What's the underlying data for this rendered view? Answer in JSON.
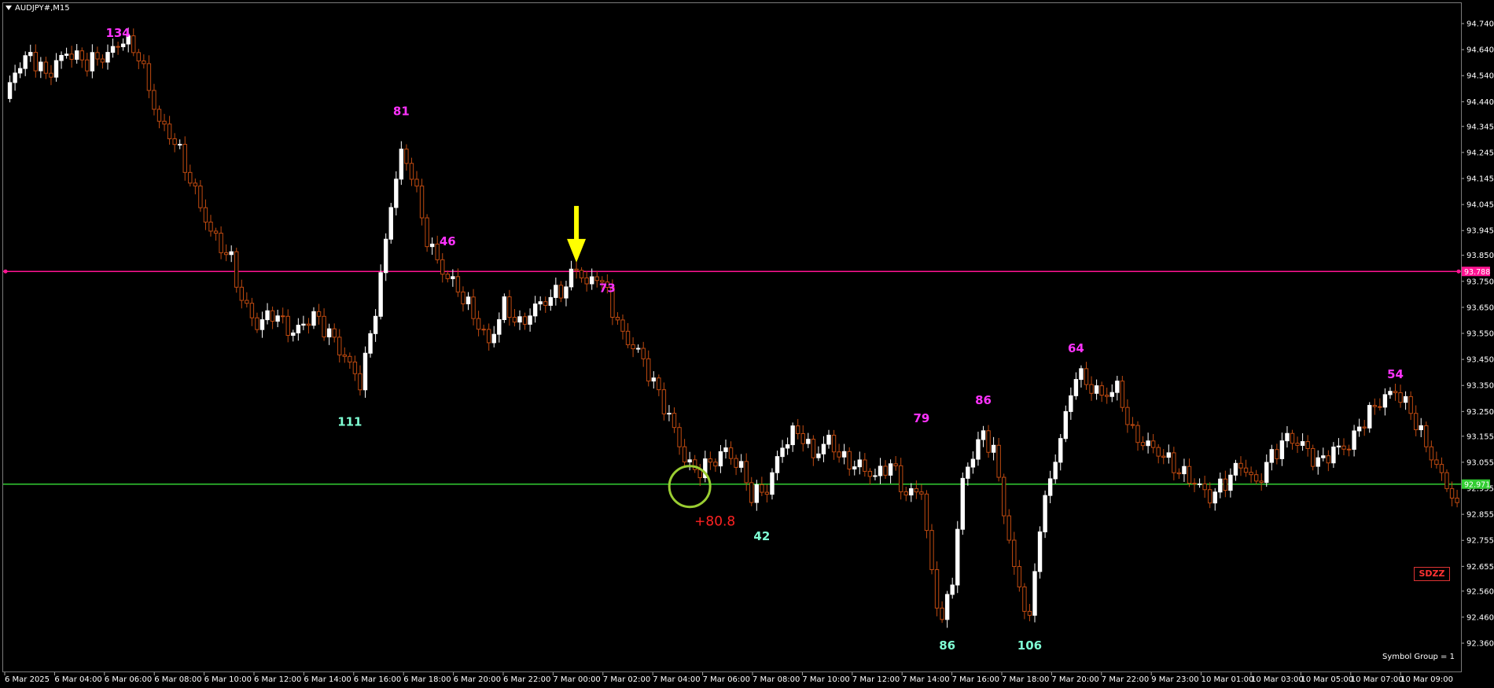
{
  "window": {
    "symbol_title": "AUDJPY#,M15"
  },
  "colors": {
    "background": "#000000",
    "bull_candle": "#ffffff",
    "bear_candle": "#c04a10",
    "magenta_label": "#ff33ff",
    "cyan_label": "#7fffd4",
    "pink_line": "#ff1493",
    "green_line": "#32cd32",
    "arrow": "#ffff00",
    "circle": "#9acd32",
    "profit": "#ff2222"
  },
  "price_axis": {
    "min": 92.36,
    "max": 94.74,
    "ticks": [
      "94.740",
      "94.640",
      "94.540",
      "94.440",
      "94.345",
      "94.245",
      "94.145",
      "94.045",
      "93.945",
      "93.850",
      "93.750",
      "93.650",
      "93.550",
      "93.450",
      "93.350",
      "93.250",
      "93.155",
      "93.055",
      "92.955",
      "92.855",
      "92.755",
      "92.655",
      "92.560",
      "92.460",
      "92.360"
    ]
  },
  "time_axis": {
    "labels": [
      "6 Mar 2025",
      "6 Mar 04:00",
      "6 Mar 06:00",
      "6 Mar 08:00",
      "6 Mar 10:00",
      "6 Mar 12:00",
      "6 Mar 14:00",
      "6 Mar 16:00",
      "6 Mar 18:00",
      "6 Mar 20:00",
      "6 Mar 22:00",
      "7 Mar 00:00",
      "7 Mar 02:00",
      "7 Mar 04:00",
      "7 Mar 06:00",
      "7 Mar 08:00",
      "7 Mar 10:00",
      "7 Mar 12:00",
      "7 Mar 14:00",
      "7 Mar 16:00",
      "7 Mar 18:00",
      "7 Mar 20:00",
      "7 Mar 22:00",
      "9 Mar 23:00",
      "10 Mar 01:00",
      "10 Mar 03:00",
      "10 Mar 05:00",
      "10 Mar 07:00",
      "10 Mar 09:00"
    ]
  },
  "levels": {
    "pink": {
      "price": 93.788,
      "label": "93.788"
    },
    "green": {
      "price": 92.971,
      "label": "92.971"
    }
  },
  "annotations": {
    "top_labels": [
      {
        "text": "134",
        "index": 22,
        "price": 94.67
      },
      {
        "text": "81",
        "index": 77,
        "price": 94.37
      },
      {
        "text": "46",
        "index": 86,
        "price": 93.87
      },
      {
        "text": "73",
        "index": 117,
        "price": 93.69
      },
      {
        "text": "79",
        "index": 178,
        "price": 93.19
      },
      {
        "text": "86",
        "index": 190,
        "price": 93.26
      },
      {
        "text": "64",
        "index": 208,
        "price": 93.46
      },
      {
        "text": "54",
        "index": 270,
        "price": 93.36
      }
    ],
    "bottom_labels": [
      {
        "text": "111",
        "index": 67,
        "price": 93.25
      },
      {
        "text": "42",
        "index": 147,
        "price": 92.81
      },
      {
        "text": "86",
        "index": 183,
        "price": 92.39
      },
      {
        "text": "106",
        "index": 199,
        "price": 92.39
      }
    ],
    "profit_text": "+80.8",
    "sell_arrow_index": 111,
    "sell_arrow_price": 93.81,
    "circle_index": 133,
    "circle_price": 92.98
  },
  "badge": {
    "text": "SDZZ"
  },
  "footer": {
    "symbol_group": "Symbol Group = 1"
  }
}
